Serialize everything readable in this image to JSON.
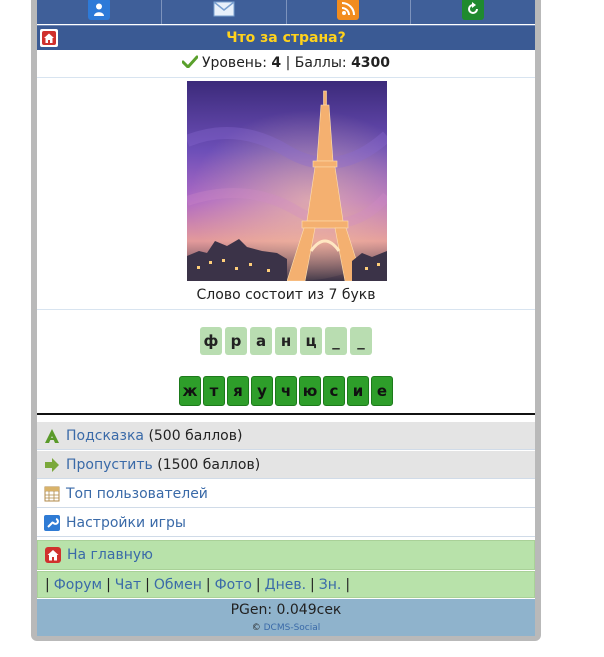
{
  "topbar": {
    "icons": [
      "user-icon",
      "mail-icon",
      "rss-icon",
      "refresh-icon"
    ]
  },
  "header": {
    "title": "Что за страна?"
  },
  "status": {
    "level_label": "Уровень:",
    "level_value": "4",
    "separator": "|",
    "points_label": "Баллы:",
    "points_value": "4300"
  },
  "puzzle": {
    "word_info": "Слово состоит из 7 букв",
    "answer_slots": [
      "ф",
      "р",
      "а",
      "н",
      "ц",
      "_",
      "_"
    ],
    "letters": [
      "ж",
      "т",
      "я",
      "у",
      "ч",
      "ю",
      "с",
      "и",
      "е"
    ]
  },
  "menu": {
    "hint_link": "Подсказка",
    "hint_cost": "(500 баллов)",
    "skip_link": "Пропустить",
    "skip_cost": "(1500 баллов)",
    "top_users": "Топ пользователей",
    "settings": "Настройки игры",
    "home": "На главную"
  },
  "footer_nav": {
    "items": [
      "Форум",
      "Чат",
      "Обмен",
      "Фото",
      "Днев.",
      "Зн."
    ]
  },
  "footer": {
    "pgen": "PGen: 0.049сек",
    "copyright_symbol": "©",
    "copyright_link": "DCMS-Social"
  },
  "colors": {
    "header_bg": "#3a5a94",
    "title_color": "#ffd21c",
    "tile_green": "#2e9e2a",
    "tile_light": "#b9ddb1",
    "footer_bg": "#8fb3cc",
    "link": "#3a6aa8"
  }
}
